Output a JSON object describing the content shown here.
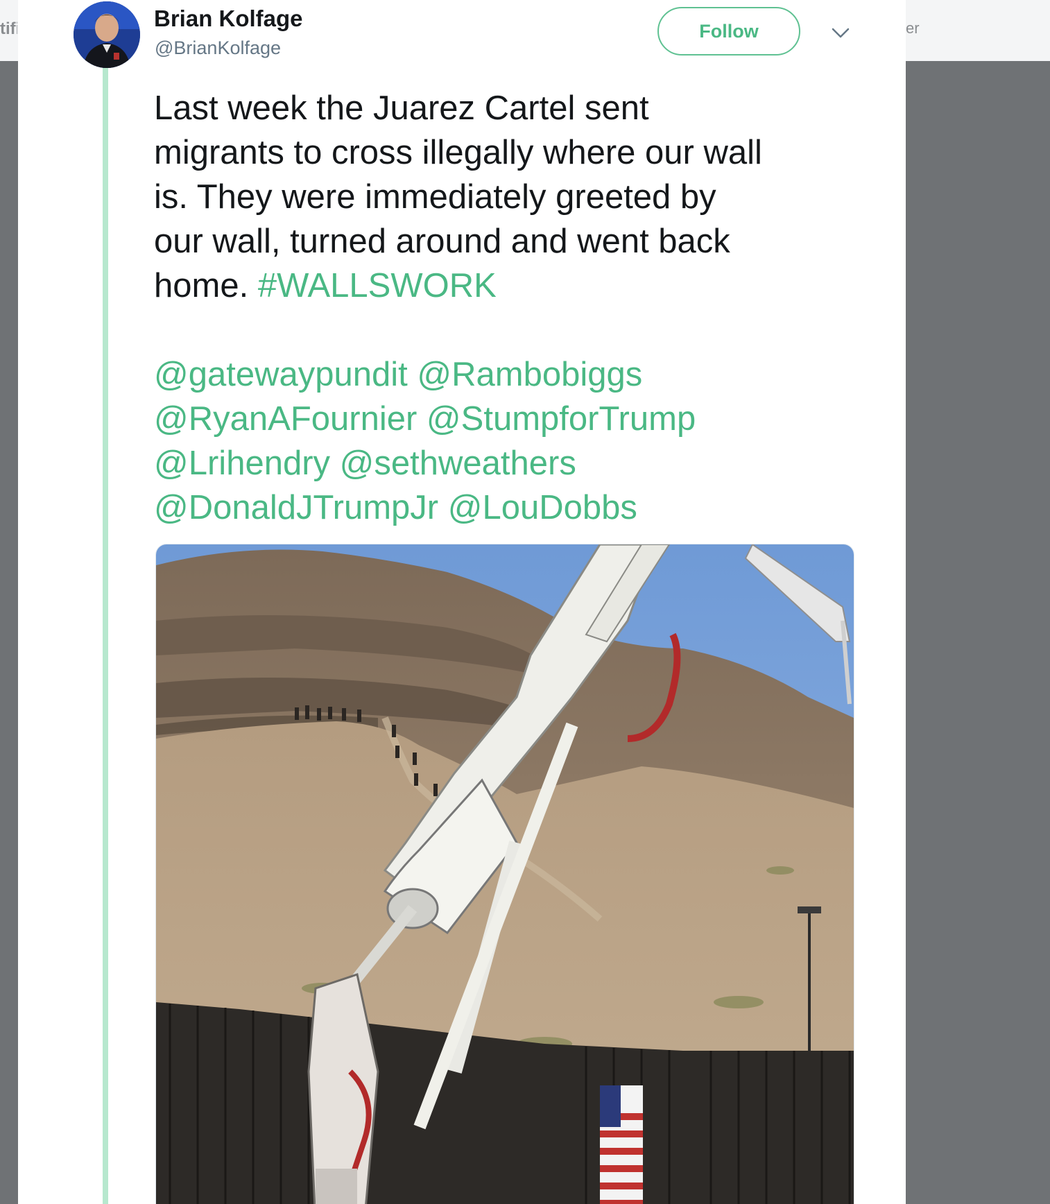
{
  "background": {
    "left_text": "tifi",
    "right_text": "er"
  },
  "tweet": {
    "author_name": "Brian Kolfage",
    "author_handle": "@BrianKolfage",
    "follow_label": "Follow",
    "menu_icon": "chevron-down-icon",
    "text_lines": [
      "Last week the Juarez Cartel sent",
      "migrants to cross illegally where our wall",
      "is. They were immediately greeted by",
      "our wall, turned around and went back",
      "home."
    ],
    "hashtag": "#WALLSWORK",
    "mention_lines": [
      [
        "@gatewaypundit",
        "@Rambobiggs"
      ],
      [
        "@RyanAFournier",
        "@StumpforTrump"
      ],
      [
        "@Lrihendry",
        "@sethweathers"
      ],
      [
        "@DonaldJTrumpJr",
        "@LouDobbs"
      ]
    ]
  },
  "colors": {
    "link": "#4ab884",
    "thread_line": "#b7e8ce",
    "text": "#14171a",
    "handle": "#657786"
  }
}
